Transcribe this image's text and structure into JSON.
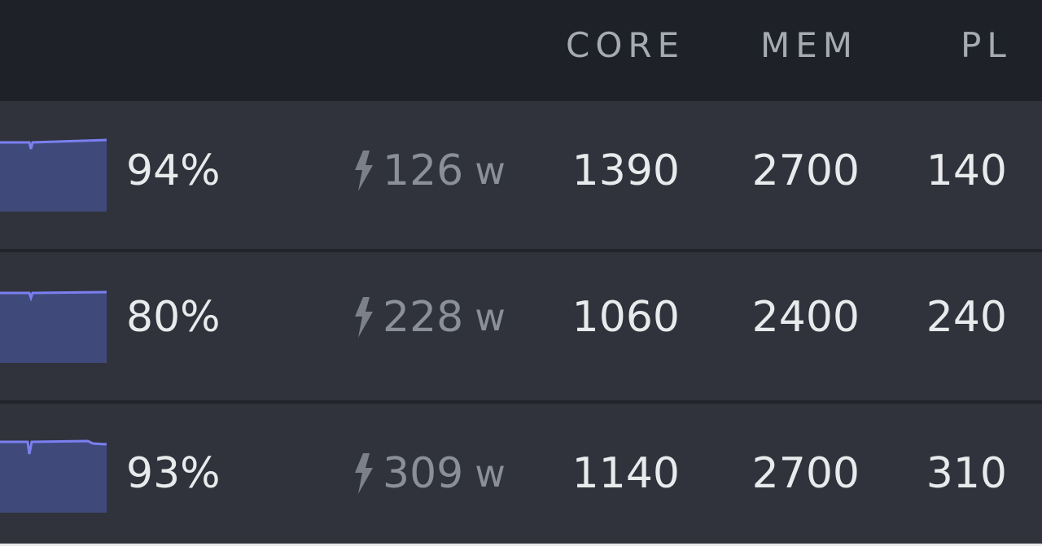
{
  "header": {
    "core": "CORE",
    "mem": "MEM",
    "pl": "PL"
  },
  "colors": {
    "header_bg": "#1f2129",
    "row_bg": "#30333c",
    "sparkline_line": "#7b7ff0",
    "sparkline_fill": "#3f4a7a"
  },
  "rows": [
    {
      "utilization": "94%",
      "power": "126",
      "power_unit": "w",
      "core": "1390",
      "mem": "2700",
      "pl": "140"
    },
    {
      "utilization": "80%",
      "power": "228",
      "power_unit": "w",
      "core": "1060",
      "mem": "2400",
      "pl": "240"
    },
    {
      "utilization": "93%",
      "power": "309",
      "power_unit": "w",
      "core": "1140",
      "mem": "2700",
      "pl": "310"
    }
  ]
}
